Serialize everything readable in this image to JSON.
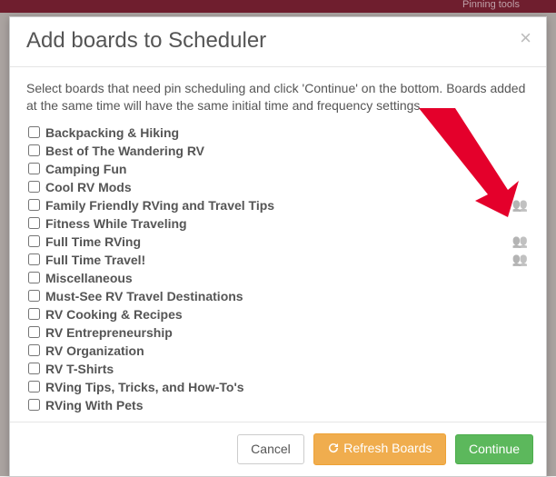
{
  "topbar": {
    "pinning": "Pinning tools"
  },
  "modal": {
    "title": "Add boards to Scheduler",
    "description": "Select boards that need pin scheduling and click 'Continue' on the bottom. Boards added at the same time will have the same initial time and frequency settings.",
    "buttons": {
      "cancel": "Cancel",
      "refresh": "Refresh Boards",
      "continue": "Continue"
    }
  },
  "boards": [
    {
      "name": "Backpacking & Hiking",
      "group": false
    },
    {
      "name": "Best of The Wandering RV",
      "group": false
    },
    {
      "name": "Camping Fun",
      "group": false
    },
    {
      "name": "Cool RV Mods",
      "group": false
    },
    {
      "name": "Family Friendly RVing and Travel Tips",
      "group": true
    },
    {
      "name": "Fitness While Traveling",
      "group": false
    },
    {
      "name": "Full Time RVing",
      "group": true
    },
    {
      "name": "Full Time Travel!",
      "group": true
    },
    {
      "name": "Miscellaneous",
      "group": false
    },
    {
      "name": "Must-See RV Travel Destinations",
      "group": false
    },
    {
      "name": "RV Cooking & Recipes",
      "group": false
    },
    {
      "name": "RV Entrepreneurship",
      "group": false
    },
    {
      "name": "RV Organization",
      "group": false
    },
    {
      "name": "RV T-Shirts",
      "group": false
    },
    {
      "name": "RVing Tips, Tricks, and How-To's",
      "group": false
    },
    {
      "name": "RVing With Pets",
      "group": false
    }
  ]
}
